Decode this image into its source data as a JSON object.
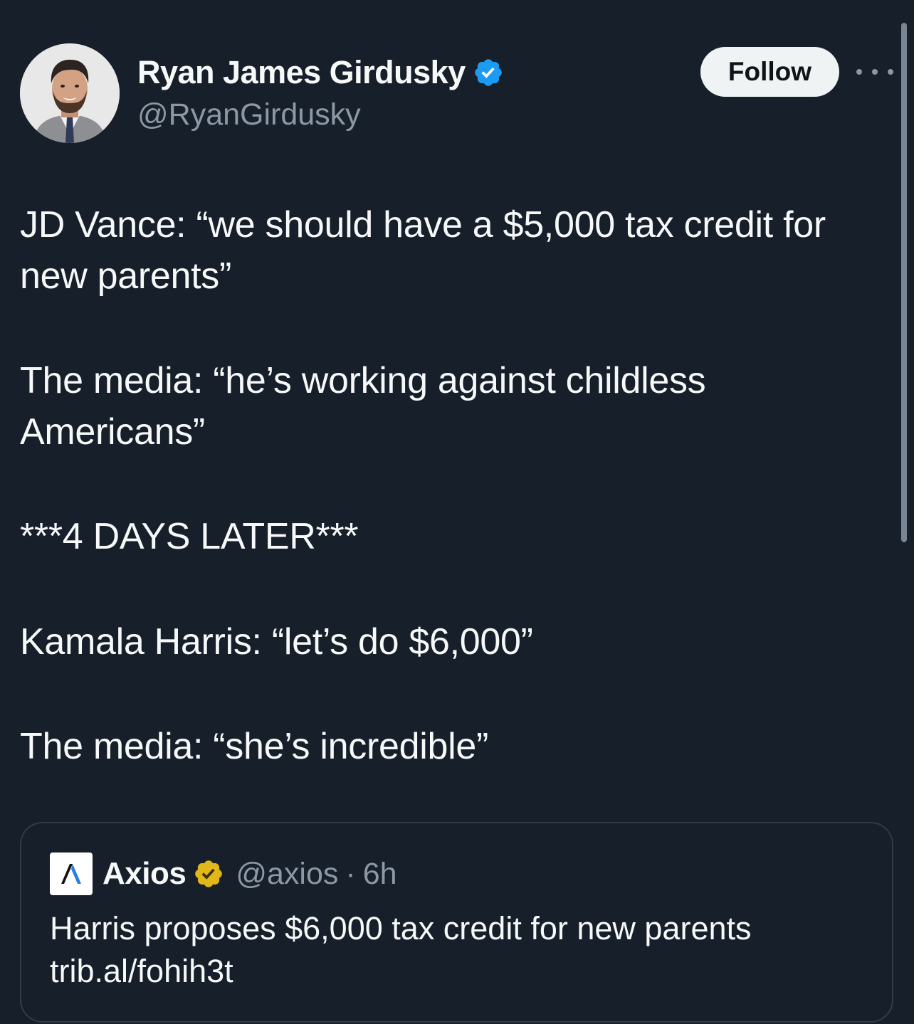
{
  "author": {
    "display_name": "Ryan James Girdusky",
    "handle": "@RyanGirdusky",
    "verified_icon": "verified-badge-blue",
    "verified_color": "#1d9bf0"
  },
  "actions": {
    "follow_label": "Follow",
    "more_icon": "more-dots-icon"
  },
  "tweet": {
    "lines": [
      "JD Vance: “we should have a $5,000 tax credit for",
      "new parents”",
      "The media: “he’s working against childless",
      "Americans”",
      "***4 DAYS LATER***",
      "Kamala Harris: “let’s do $6,000”",
      "The media: “she’s incredible”"
    ]
  },
  "quoted": {
    "logo_icon": "axios-logo-icon",
    "name": "Axios",
    "badge_icon": "verified-badge-gold",
    "badge_color": "#e2b719",
    "handle": "@axios",
    "separator": "·",
    "time": "6h",
    "text_line1": "Harris proposes $6,000 tax credit for new parents",
    "text_line2": "trib.al/fohih3t"
  },
  "colors": {
    "background": "#161f2a",
    "text": "#f7f9f9",
    "secondary": "#8b98a5",
    "border": "#2f3c4a"
  }
}
